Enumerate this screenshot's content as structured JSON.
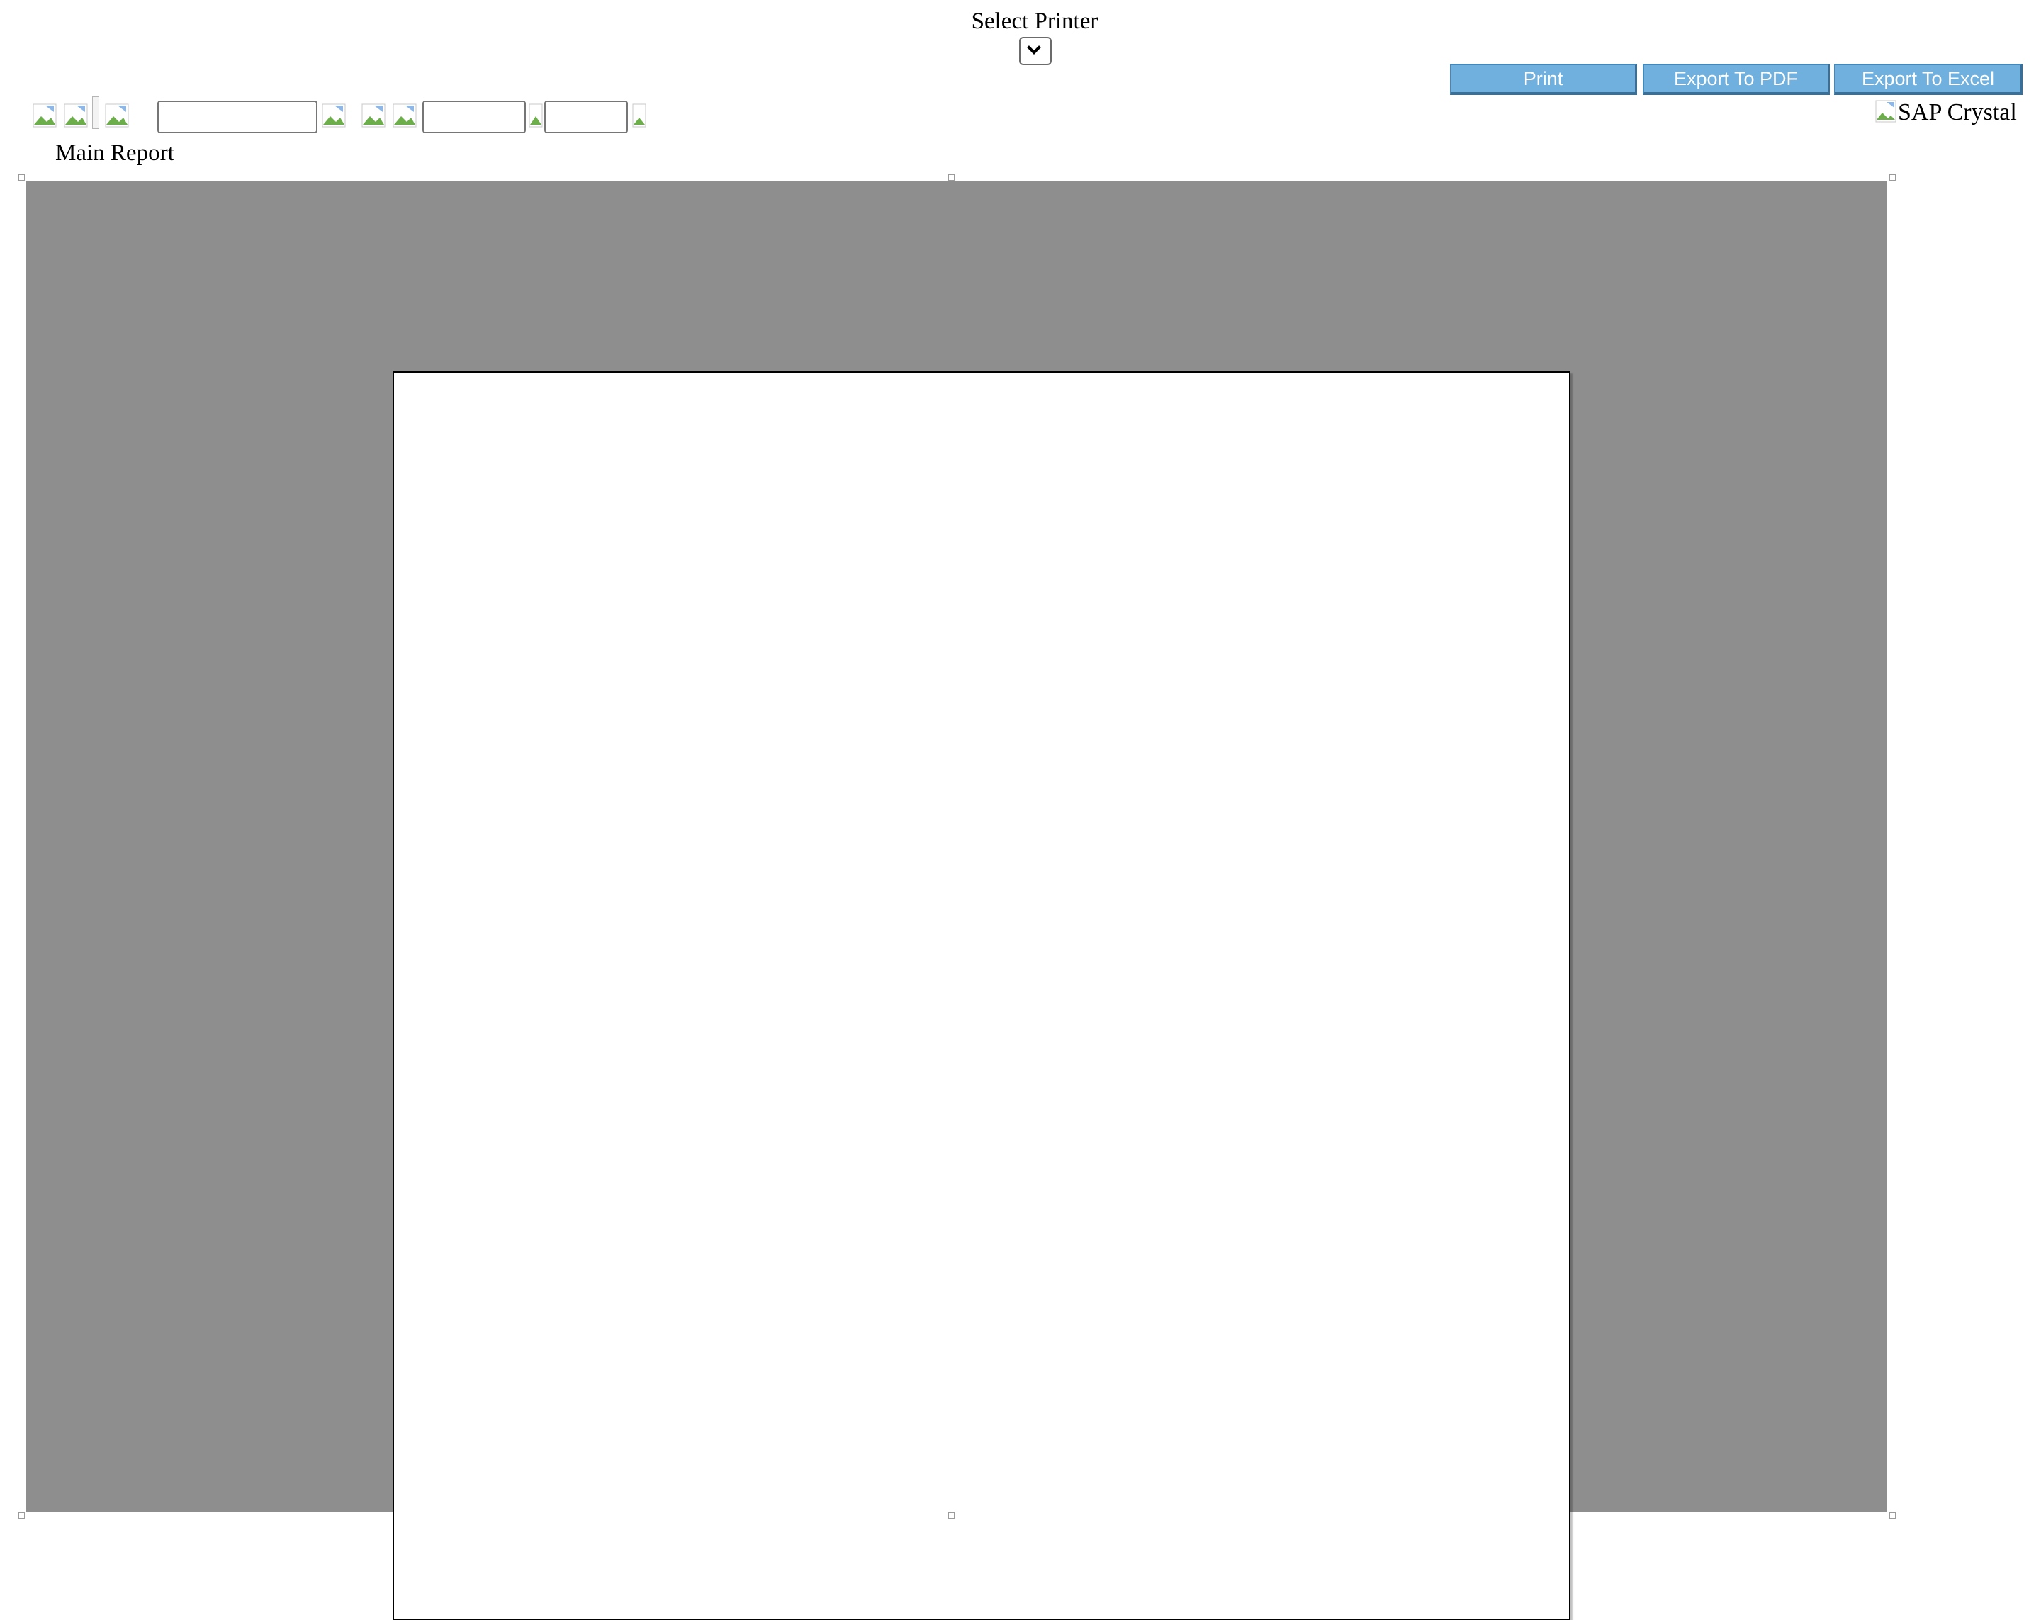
{
  "printer": {
    "label": "Select Printer",
    "selected_value": ""
  },
  "actions": {
    "print_label": "Print",
    "export_pdf_label": "Export To PDF",
    "export_excel_label": "Export To Excel"
  },
  "toolbar": {
    "search_value": "",
    "page_number_value": "",
    "zoom_value": "",
    "logo_alt": "SAP Crystal"
  },
  "tabs": {
    "main_report_label": "Main Report"
  },
  "colors": {
    "button_bg": "#6fb0de",
    "viewer_bg": "#8e8e8e"
  }
}
